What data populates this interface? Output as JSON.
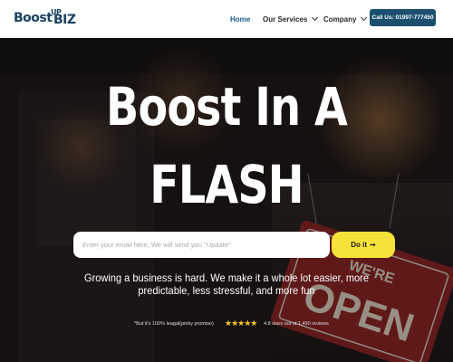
{
  "header": {
    "logo": {
      "boost": "Boost",
      "up": "UP",
      "biz": "BIZ"
    },
    "nav": {
      "home": "Home",
      "services": "Our Services",
      "company": "Company"
    },
    "call_button": "Call Us: 01997-777450"
  },
  "hero": {
    "title_line1": "Boost In A",
    "title_line2": "FLASH",
    "email_placeholder": "Enter your email here, We will send you \"Update\"",
    "cta_label": "Do it",
    "cta_arrow": "➞",
    "tagline": "Growing a business is hard. We make it a whole lot easier, more predictable, less stressful, and more fun",
    "legal_note": "*But it's 100% leagal(pinky promise)",
    "stars": "★★★★★",
    "rating_text": "4.8 stars out of 1,490 reviews",
    "sign_text": "OPEN",
    "sign_text_top": "WE'RE"
  },
  "colors": {
    "brand_navy": "#1a4263",
    "call_button_bg": "#1a4f6f",
    "nav_active": "#1c5d8a",
    "cta_yellow": "#f7e23a",
    "star_color": "#f7c52a"
  }
}
